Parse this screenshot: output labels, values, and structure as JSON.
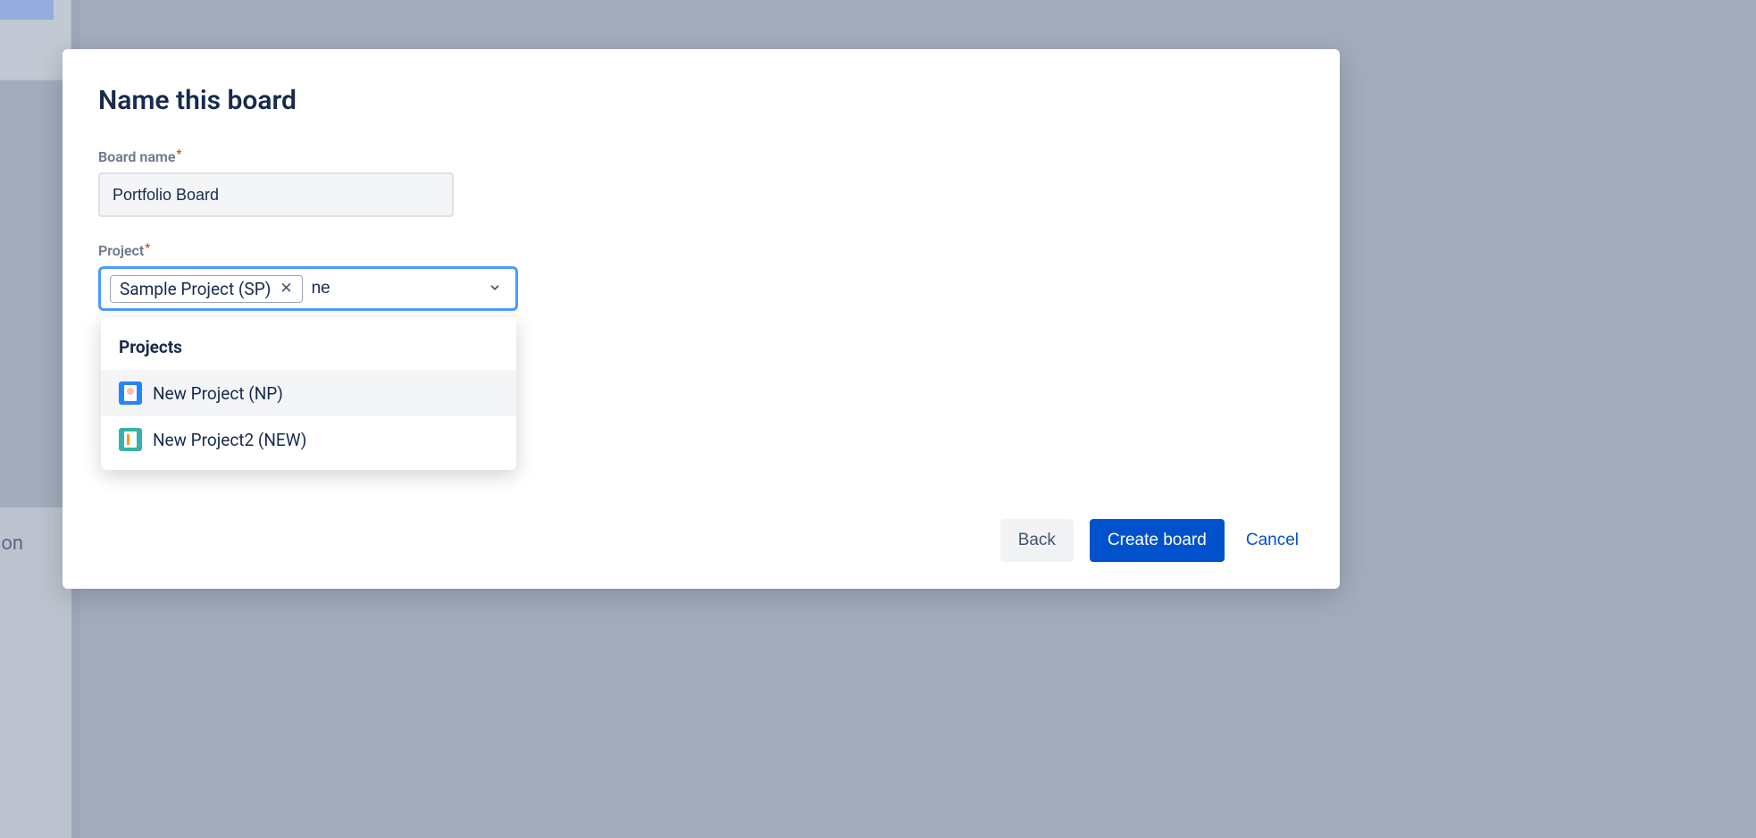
{
  "bg": {
    "truncated_text": "ion"
  },
  "modal": {
    "title": "Name this board",
    "board_name_label": "Board name",
    "board_name_value": "Portfolio Board",
    "project_label": "Project",
    "project_chip": "Sample Project (SP)",
    "project_search_text": "ne",
    "dropdown": {
      "heading": "Projects",
      "items": [
        {
          "label": "New Project (NP)",
          "icon": "blue"
        },
        {
          "label": "New Project2 (NEW)",
          "icon": "teal"
        }
      ]
    },
    "buttons": {
      "back": "Back",
      "create": "Create board",
      "cancel": "Cancel"
    }
  }
}
